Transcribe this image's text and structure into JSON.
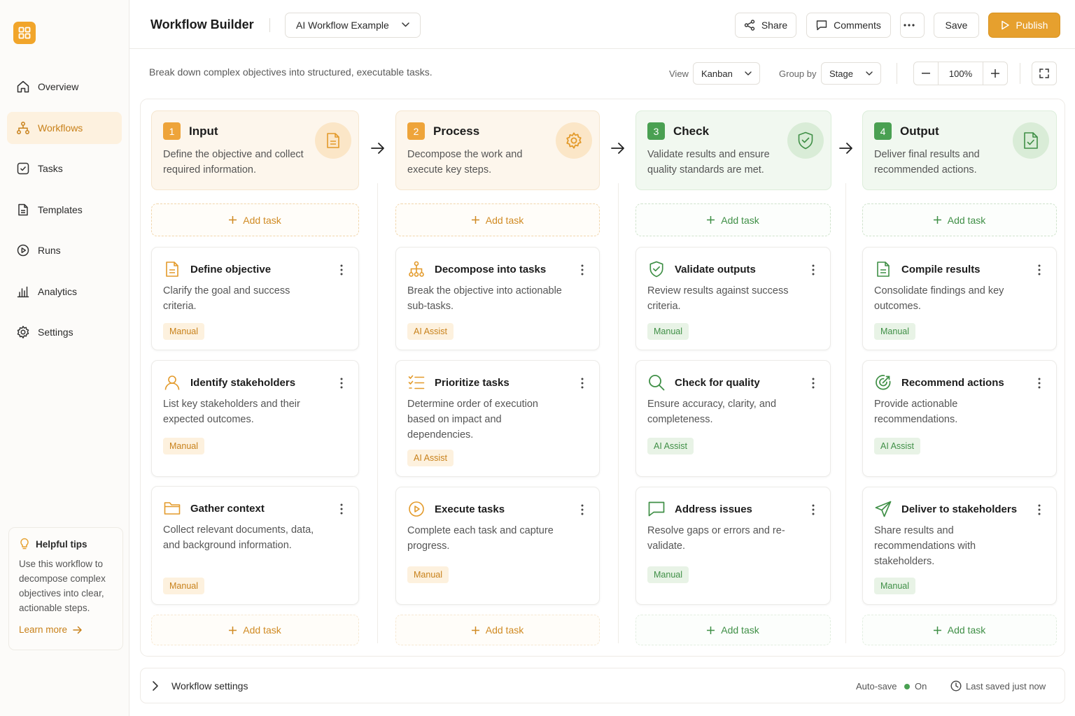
{
  "sidebar": {
    "nav": [
      {
        "label": "Overview",
        "icon": "home-icon"
      },
      {
        "label": "Workflows",
        "icon": "workflow-icon",
        "active": true
      },
      {
        "label": "Tasks",
        "icon": "checkbox-icon"
      },
      {
        "label": "Templates",
        "icon": "document-icon"
      },
      {
        "label": "Runs",
        "icon": "play-icon"
      },
      {
        "label": "Analytics",
        "icon": "bar-chart-icon"
      },
      {
        "label": "Settings",
        "icon": "gear-icon"
      }
    ],
    "tips": {
      "title": "Helpful tips",
      "body": "Use this workflow to decompose complex objectives into clear, actionable steps.",
      "link": "Learn more"
    }
  },
  "header": {
    "title": "Workflow Builder",
    "workflow_select": "AI Workflow Example",
    "share": "Share",
    "comments": "Comments",
    "save": "Save",
    "publish": "Publish"
  },
  "toolbar": {
    "subtitle": "Break down complex objectives into structured, executable tasks.",
    "view_label": "View",
    "view_value": "Kanban",
    "group_label": "Group by",
    "group_value": "Stage",
    "zoom": "100%"
  },
  "stages": [
    {
      "num": "1",
      "title": "Input",
      "desc": "Define the objective and collect required information.",
      "theme": "orange",
      "add_label": "Add task",
      "tasks": [
        {
          "title": "Define objective",
          "desc": "Clarify the goal and success criteria.",
          "badge": "Manual",
          "icon": "document-icon"
        },
        {
          "title": "Identify stakeholders",
          "desc": "List key stakeholders and their expected outcomes.",
          "badge": "Manual",
          "icon": "user-icon"
        },
        {
          "title": "Gather context",
          "desc": "Collect relevant documents, data, and background information.",
          "badge": "Manual",
          "icon": "folder-icon"
        }
      ]
    },
    {
      "num": "2",
      "title": "Process",
      "desc": "Decompose the work and execute key steps.",
      "theme": "orange",
      "add_label": "Add task",
      "tasks": [
        {
          "title": "Decompose into tasks",
          "desc": "Break the objective into actionable sub-tasks.",
          "badge": "AI Assist",
          "icon": "hierarchy-icon"
        },
        {
          "title": "Prioritize tasks",
          "desc": "Determine order of execution based on impact and dependencies.",
          "badge": "AI Assist",
          "icon": "list-icon"
        },
        {
          "title": "Execute tasks",
          "desc": "Complete each task and capture progress.",
          "badge": "Manual",
          "icon": "play-circle-icon"
        }
      ]
    },
    {
      "num": "3",
      "title": "Check",
      "desc": "Validate results and ensure quality standards are met.",
      "theme": "green",
      "add_label": "Add task",
      "tasks": [
        {
          "title": "Validate outputs",
          "desc": "Review results against success criteria.",
          "badge": "Manual",
          "icon": "shield-check-icon"
        },
        {
          "title": "Check for quality",
          "desc": "Ensure accuracy, clarity, and completeness.",
          "badge": "AI Assist",
          "icon": "search-icon"
        },
        {
          "title": "Address issues",
          "desc": "Resolve gaps or errors and re-validate.",
          "badge": "Manual",
          "icon": "chat-icon"
        }
      ]
    },
    {
      "num": "4",
      "title": "Output",
      "desc": "Deliver final results and recommended actions.",
      "theme": "green",
      "add_label": "Add task",
      "tasks": [
        {
          "title": "Compile results",
          "desc": "Consolidate findings and key outcomes.",
          "badge": "Manual",
          "icon": "document-icon"
        },
        {
          "title": "Recommend actions",
          "desc": "Provide actionable recommendations.",
          "badge": "AI Assist",
          "icon": "target-icon"
        },
        {
          "title": "Deliver to stakeholders",
          "desc": "Share results and recommendations with stakeholders.",
          "badge": "Manual",
          "icon": "send-icon"
        }
      ]
    }
  ],
  "footer": {
    "settings": "Workflow settings",
    "autosave_label": "Auto-save",
    "autosave_value": "On",
    "last_saved": "Last saved just now"
  },
  "colors": {
    "accent": "#e6a02e",
    "accent_text": "#c8811a",
    "green": "#4aa052",
    "green_text": "#3f8f46"
  }
}
